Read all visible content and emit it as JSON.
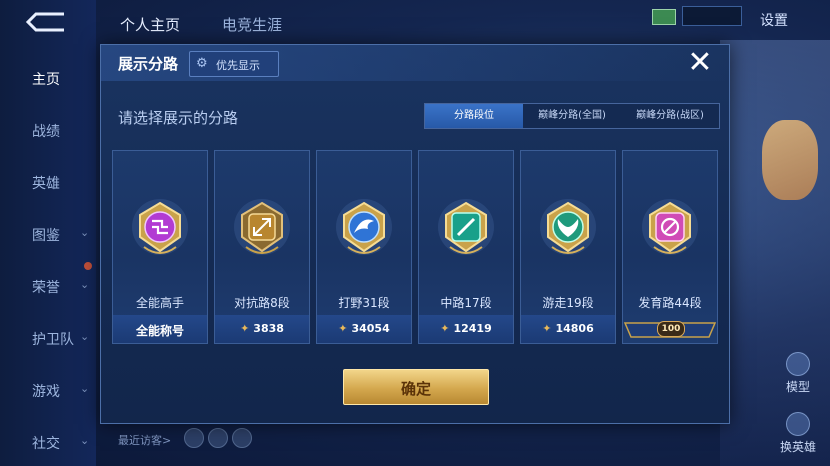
{
  "nav": {
    "items": [
      {
        "label": "主页",
        "chevron": false,
        "active": true
      },
      {
        "label": "战绩",
        "chevron": false
      },
      {
        "label": "英雄",
        "chevron": false
      },
      {
        "label": "图鉴",
        "chevron": true
      },
      {
        "label": "荣誉",
        "chevron": true
      },
      {
        "label": "护卫队",
        "chevron": true
      },
      {
        "label": "游戏",
        "chevron": true
      },
      {
        "label": "社交",
        "chevron": true
      }
    ]
  },
  "top": {
    "tabs": [
      "个人主页",
      "电竞生涯"
    ],
    "settings": "设置"
  },
  "bottom": {
    "recent_visitors": "最近访客>"
  },
  "right": {
    "model": "模型",
    "change_hero": "换英雄"
  },
  "dialog": {
    "title": "展示分路",
    "priority_label": "优先显示",
    "close_glyph": "✕",
    "subtitle": "请选择展示的分路",
    "segments": [
      {
        "label": "分路段位",
        "active": true
      },
      {
        "label": "巅峰分路(全国)"
      },
      {
        "label": "巅峰分路(战区)"
      }
    ],
    "cards": [
      {
        "name": "全能高手",
        "bottom_text": "全能称号",
        "points": null,
        "badge": "allround",
        "color": "#b23bd3"
      },
      {
        "name": "对抗路8段",
        "bottom_text": null,
        "points": "3838",
        "badge": "clash",
        "color": "#b8862f"
      },
      {
        "name": "打野31段",
        "bottom_text": null,
        "points": "34054",
        "badge": "jungle",
        "color": "#2f74d6"
      },
      {
        "name": "中路17段",
        "bottom_text": null,
        "points": "12419",
        "badge": "mid",
        "color": "#19a08a"
      },
      {
        "name": "游走19段",
        "bottom_text": null,
        "points": "14806",
        "badge": "roam",
        "color": "#1f9a7c"
      },
      {
        "name": "发育路44段",
        "bottom_text": null,
        "points": null,
        "rank_value": "100",
        "badge": "farm",
        "color": "#d04bb6"
      }
    ],
    "confirm_label": "确定"
  },
  "colors": {
    "accent_blue": "#3a73c8",
    "gold": "#d4a84e",
    "panel": "#1a3461"
  }
}
